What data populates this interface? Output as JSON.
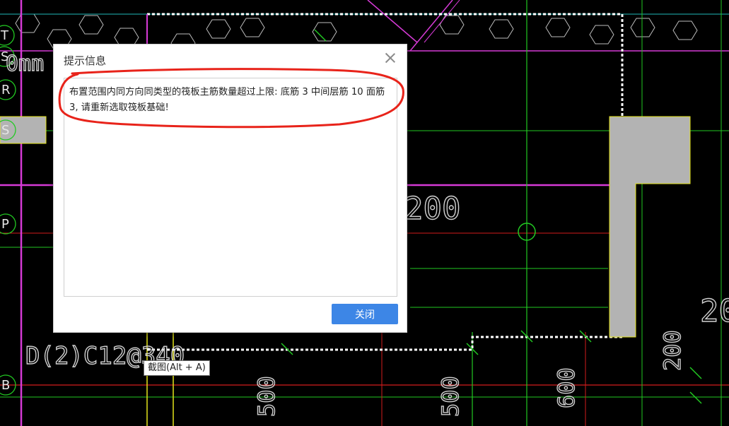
{
  "cad": {
    "axis_labels": [
      "T",
      "S",
      "R",
      "S",
      "P",
      "B"
    ],
    "annotations": {
      "top_left": "0mm",
      "dim_200_mid": "200",
      "dim_20_right": "20",
      "beam_label": "D(2)C12@340",
      "dim_500_a": "500",
      "dim_500_b": "500",
      "dim_600": "600",
      "dim_200_right": "200"
    },
    "colors": {
      "magenta": "#d63ad6",
      "green": "#22c922",
      "red": "#d21c1c",
      "yellow": "#e3e31a",
      "gray_fill": "#b3b3b3",
      "annotation_red": "#e8231a"
    }
  },
  "dialog": {
    "title": "提示信息",
    "message": "布置范围内同方向同类型的筏板主筋数量超过上限: 底筋 3 中间层筋 10 面筋 3, 请重新选取筏板基础!",
    "ok_label": "关闭"
  },
  "tooltip": {
    "text": "截图(Alt + A)"
  }
}
